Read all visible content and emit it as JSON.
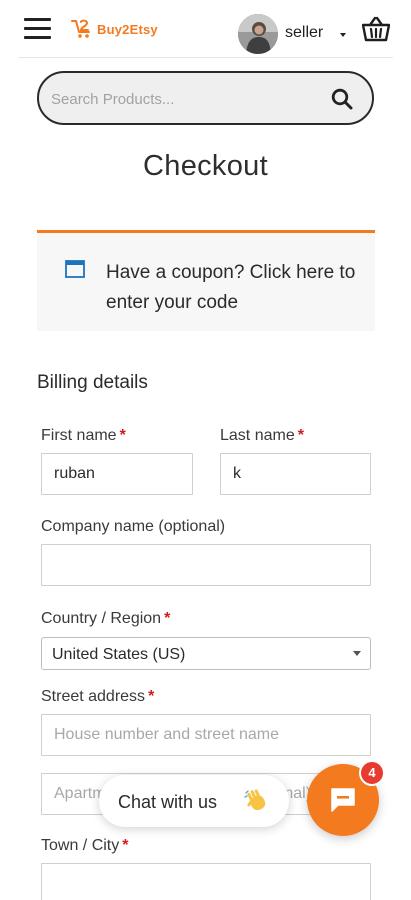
{
  "header": {
    "brand": "Buy2Etsy",
    "user_label": "seller",
    "brand_color": "#f47a20"
  },
  "search": {
    "placeholder": "Search Products..."
  },
  "page": {
    "title": "Checkout"
  },
  "coupon": {
    "text": "Have a coupon? Click here to enter your code"
  },
  "billing": {
    "heading": "Billing details",
    "required_mark": "*",
    "first_name": {
      "label": "First name",
      "value": "ruban"
    },
    "last_name": {
      "label": "Last name",
      "value": "k"
    },
    "company": {
      "label": "Company name (optional)",
      "value": ""
    },
    "country": {
      "label": "Country / Region",
      "value": "United States (US)"
    },
    "street": {
      "label": "Street address",
      "line1_placeholder": "House number and street name",
      "line2_placeholder": "Apartment, suite, unit, etc. (optional)"
    },
    "city": {
      "label": "Town / City",
      "value": ""
    }
  },
  "chat": {
    "label": "Chat with us",
    "badge_count": "4",
    "accent_color": "#f47a20",
    "badge_color": "#e63b2e"
  }
}
